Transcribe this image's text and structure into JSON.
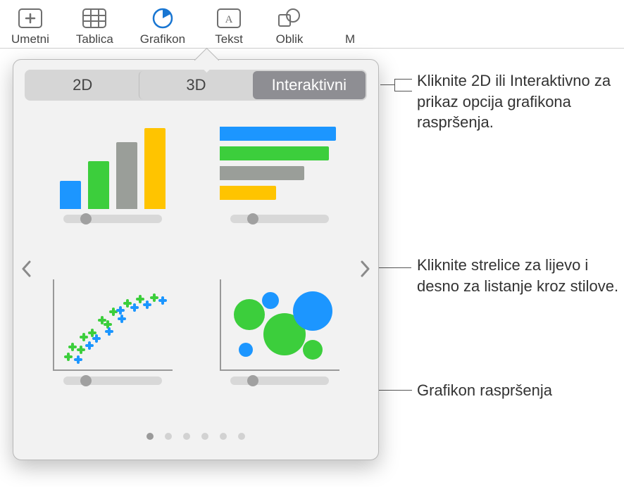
{
  "toolbar": {
    "items": [
      {
        "label": "Umetni"
      },
      {
        "label": "Tablica"
      },
      {
        "label": "Grafikon"
      },
      {
        "label": "Tekst"
      },
      {
        "label": "Oblik"
      },
      {
        "label": "M"
      }
    ]
  },
  "popover": {
    "tabs": {
      "tab_2d": "2D",
      "tab_3d": "3D",
      "tab_interactive": "Interaktivni"
    },
    "dot_count": 6,
    "active_dot": 0
  },
  "colors": {
    "blue": "#1c96ff",
    "green": "#3cce3c",
    "gray": "#9a9e99",
    "yellow": "#ffc400"
  },
  "callouts": {
    "tabs": "Kliknite 2D ili Interaktivno za prikaz opcija grafikona raspršenja.",
    "arrows": "Kliknite strelice za lijevo i desno za listanje kroz stilove.",
    "scatter": "Grafikon raspršenja"
  }
}
